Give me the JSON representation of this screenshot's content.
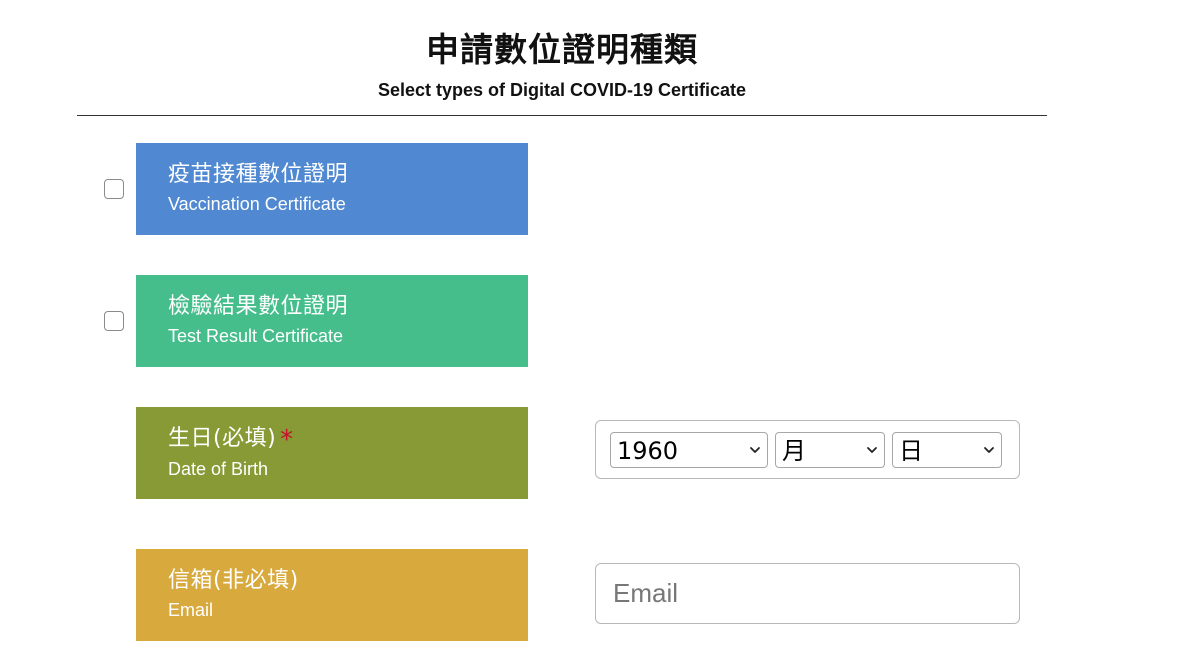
{
  "header": {
    "title": "申請數位證明種類",
    "subtitle": "Select types of Digital COVID-19 Certificate"
  },
  "vaccination": {
    "label_zh": "疫苗接種數位證明",
    "label_en": "Vaccination Certificate",
    "checked": false,
    "color": "#5089d1"
  },
  "test_result": {
    "label_zh": "檢驗結果數位證明",
    "label_en": "Test Result Certificate",
    "checked": false,
    "color": "#45be8c"
  },
  "dob": {
    "label_zh": "生日(必填)",
    "required_mark": "*",
    "label_en": "Date of Birth",
    "color": "#889a35",
    "year_value": "1960",
    "month_value": "月",
    "day_value": "日"
  },
  "email": {
    "label_zh": "信箱(非必填)",
    "label_en": "Email",
    "placeholder": "Email",
    "value": "",
    "color": "#d8a93d"
  },
  "icons": {
    "select_arrow": "chevron-down-icon",
    "required": "asterisk"
  }
}
